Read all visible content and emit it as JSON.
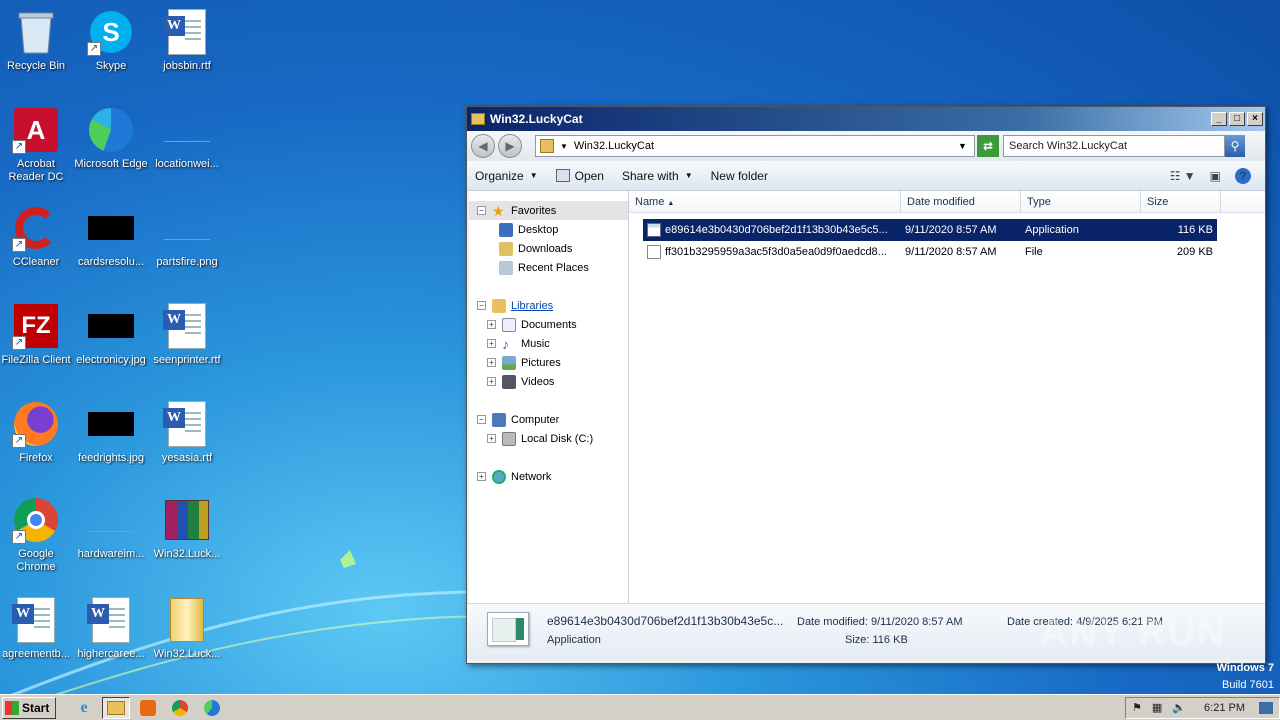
{
  "desktop": {
    "icons": [
      {
        "label": "Recycle Bin"
      },
      {
        "label": "Skype"
      },
      {
        "label": "jobsbin.rtf"
      },
      {
        "label": "Acrobat Reader DC"
      },
      {
        "label": "Microsoft Edge"
      },
      {
        "label": "locationwei..."
      },
      {
        "label": "CCleaner"
      },
      {
        "label": "cardsresolu..."
      },
      {
        "label": "partsfire.png"
      },
      {
        "label": "FileZilla Client"
      },
      {
        "label": "electronicy.jpg"
      },
      {
        "label": "seenprinter.rtf"
      },
      {
        "label": "Firefox"
      },
      {
        "label": "feedrights.jpg"
      },
      {
        "label": "yesasia.rtf"
      },
      {
        "label": "Google Chrome"
      },
      {
        "label": "hardwareim..."
      },
      {
        "label": "Win32.Luck..."
      },
      {
        "label": "agreementb..."
      },
      {
        "label": "highercaree..."
      },
      {
        "label": "Win32.Luck..."
      }
    ]
  },
  "window": {
    "title": "Win32.LuckyCat",
    "address": "Win32.LuckyCat",
    "search_placeholder": "Search Win32.LuckyCat",
    "toolbar": {
      "organize": "Organize",
      "open": "Open",
      "share_with": "Share with",
      "new_folder": "New folder"
    },
    "nav": {
      "favorites": "Favorites",
      "desktop": "Desktop",
      "downloads": "Downloads",
      "recent_places": "Recent Places",
      "libraries": "Libraries",
      "documents": "Documents",
      "music": "Music",
      "pictures": "Pictures",
      "videos": "Videos",
      "computer": "Computer",
      "local_disk": "Local Disk (C:)",
      "network": "Network"
    },
    "columns": {
      "name": "Name",
      "date_modified": "Date modified",
      "type": "Type",
      "size": "Size"
    },
    "files": [
      {
        "name": "e89614e3b0430d706bef2d1f13b30b43e5c5...",
        "date": "9/11/2020 8:57 AM",
        "type": "Application",
        "size": "116 KB"
      },
      {
        "name": "ff301b3295959a3ac5f3d0a5ea0d9f0aedcd8...",
        "date": "9/11/2020 8:57 AM",
        "type": "File",
        "size": "209 KB"
      }
    ],
    "details": {
      "name": "e89614e3b0430d706bef2d1f13b30b43e5c...",
      "type": "Application",
      "date_modified": "Date modified: 9/11/2020 8:57 AM",
      "size": "Size: 116 KB",
      "date_created": "Date created: 4/9/2025 6:21 PM"
    }
  },
  "brand": {
    "watermark": "ANY RUN",
    "os_name": "Windows 7",
    "build": "Build 7601"
  },
  "taskbar": {
    "start": "Start",
    "clock": "6:21 PM"
  }
}
